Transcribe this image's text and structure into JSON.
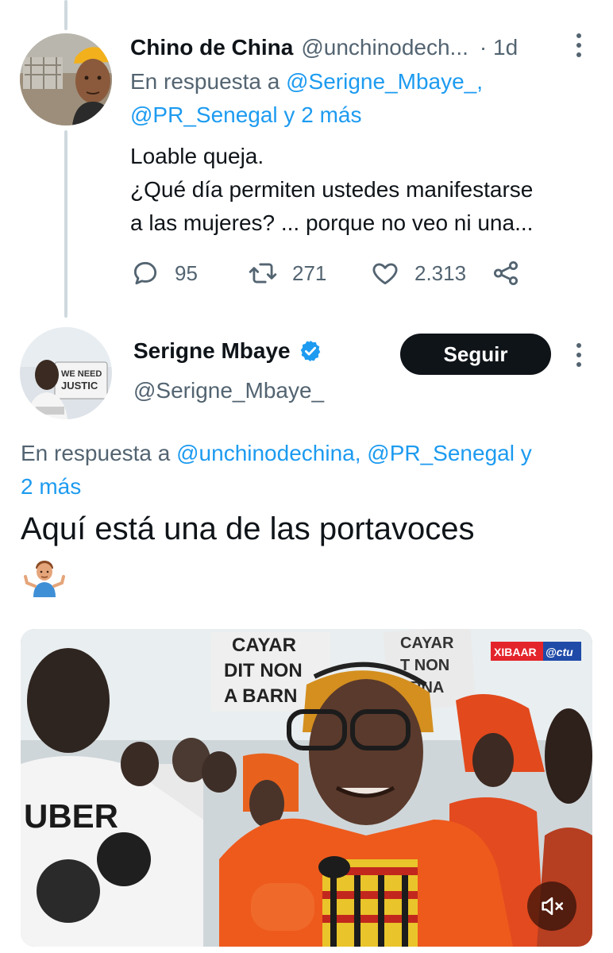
{
  "tweet1": {
    "author_name": "Chino de China",
    "handle": "@unchinodech...",
    "time": "· 1d",
    "reply_prefix": "En respuesta a ",
    "reply_mention1": "@Serigne_Mbaye_,",
    "reply_mention2": "@PR_Senegal",
    "reply_conjunction": " y 2 más",
    "text_lines": [
      "Loable queja.",
      "¿Qué día permiten ustedes manifestarse",
      "a las mujeres? ... porque no veo ni una..."
    ],
    "replies": "95",
    "retweets": "271",
    "likes": "2.313"
  },
  "tweet2": {
    "author_name": "Serigne Mbaye",
    "handle": "@Serigne_Mbaye_",
    "follow_label": "Seguir",
    "reply_prefix": "En respuesta a ",
    "reply_mention1": "@unchinodechina,",
    "reply_mention2": "@PR_Senegal",
    "reply_suffix_line1": " y",
    "reply_suffix_line2": "2 más",
    "text": "Aquí está una de las portavoces",
    "emoji": "person-shrugging",
    "avatar_sign_text": "WE NEED JUSTICE"
  },
  "media": {
    "type": "video",
    "sign_text_1": "CAYAR DIT NON A BARN",
    "sign_text_2": "CAYAR DIT NON A BARNA",
    "watermark": "XIBAAR @ctu",
    "mute_icon": "speaker-muted-icon"
  },
  "colors": {
    "accent": "#1d9bf0",
    "secondary_text": "#536471",
    "primary_text": "#0f1419",
    "button_bg": "#0f1419"
  }
}
